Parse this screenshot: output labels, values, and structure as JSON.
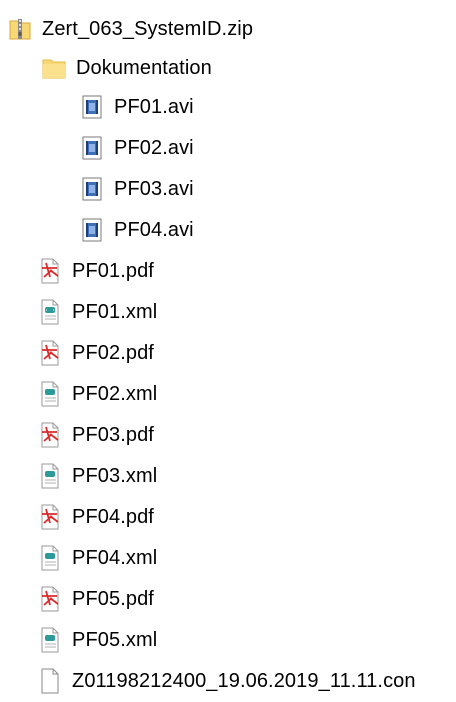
{
  "zip": {
    "label": "Zert_063_SystemID.zip",
    "icon": "zip-folder-icon"
  },
  "folder": {
    "label": "Dokumentation",
    "icon": "folder-icon"
  },
  "videos": [
    {
      "label": "PF01.avi",
      "icon": "video-file-icon"
    },
    {
      "label": "PF02.avi",
      "icon": "video-file-icon"
    },
    {
      "label": "PF03.avi",
      "icon": "video-file-icon"
    },
    {
      "label": "PF04.avi",
      "icon": "video-file-icon"
    }
  ],
  "files": [
    {
      "label": "PF01.pdf",
      "icon": "pdf-file-icon"
    },
    {
      "label": "PF01.xml",
      "icon": "xml-file-icon"
    },
    {
      "label": "PF02.pdf",
      "icon": "pdf-file-icon"
    },
    {
      "label": "PF02.xml",
      "icon": "xml-file-icon"
    },
    {
      "label": "PF03.pdf",
      "icon": "pdf-file-icon"
    },
    {
      "label": "PF03.xml",
      "icon": "xml-file-icon"
    },
    {
      "label": "PF04.pdf",
      "icon": "pdf-file-icon"
    },
    {
      "label": "PF04.xml",
      "icon": "xml-file-icon"
    },
    {
      "label": "PF05.pdf",
      "icon": "pdf-file-icon"
    },
    {
      "label": "PF05.xml",
      "icon": "xml-file-icon"
    },
    {
      "label": "Z01198212400_19.06.2019_11.11.con",
      "icon": "generic-file-icon"
    }
  ],
  "colors": {
    "folder": "#f8d775",
    "folder_dark": "#e3b94a",
    "pdf_red": "#d92b2b",
    "video_blue": "#3f6fb5",
    "xml_teal": "#2d9a9a"
  }
}
